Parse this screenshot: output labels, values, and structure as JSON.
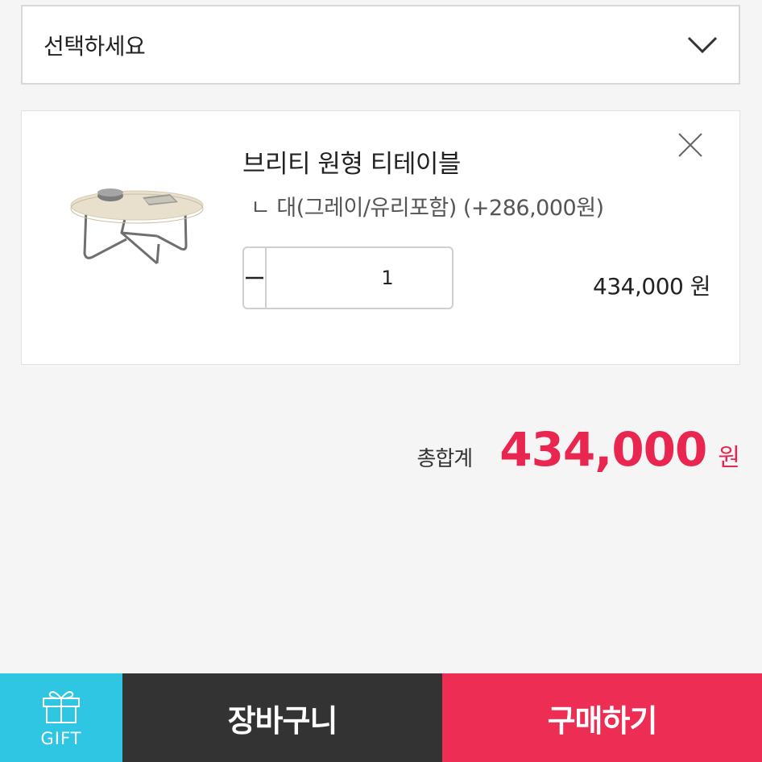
{
  "option_select": {
    "placeholder": "선택하세요",
    "icon": "chevron-down-icon"
  },
  "item": {
    "name": "브리티 원형 티테이블",
    "option": "ㄴ 대(그레이/유리포함) (+286,000원)",
    "quantity": "1",
    "price": "434,000 원",
    "image": "round-tea-table-image",
    "remove_icon": "close-icon",
    "minus_icon": "minus-icon",
    "plus_icon": "plus-icon"
  },
  "total": {
    "label": "총합계",
    "amount": "434,000",
    "unit": "원"
  },
  "bottom_bar": {
    "gift_label": "GIFT",
    "gift_icon": "gift-icon",
    "cart_label": "장바구니",
    "buy_label": "구매하기"
  },
  "colors": {
    "accent": "#e8264f",
    "buy_button": "#ee2d55",
    "cart_button": "#333333",
    "gift_button": "#2fc6e3",
    "background": "#f5f5f5"
  }
}
